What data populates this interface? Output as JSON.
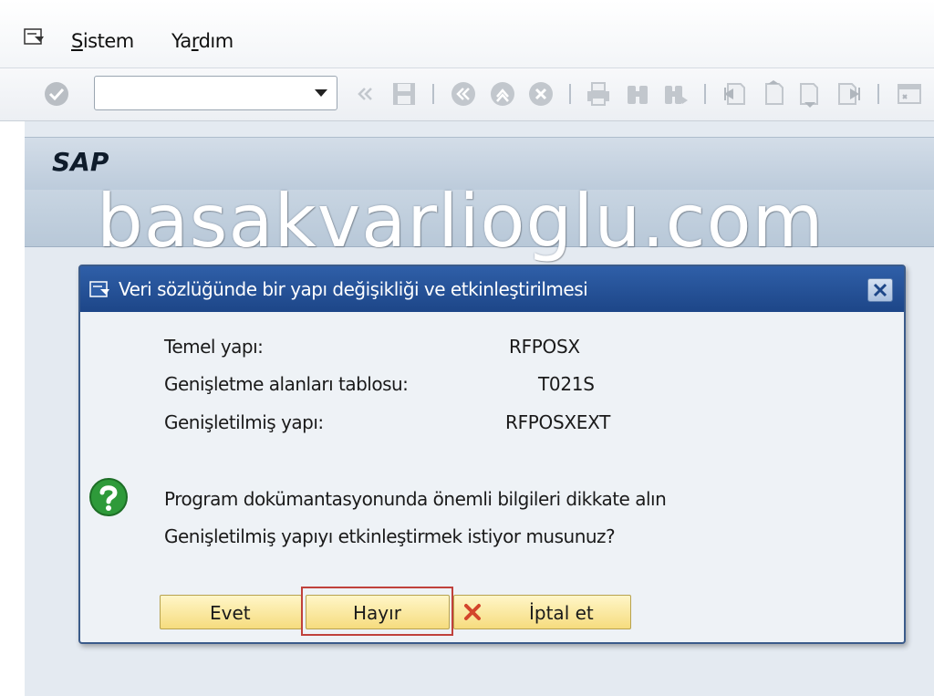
{
  "menubar": {
    "items": [
      {
        "underlined": "S",
        "rest": "istem"
      },
      {
        "pre": "Ya",
        "underlined": "r",
        "rest": "dım"
      }
    ]
  },
  "toolbar": {
    "command_field_value": "",
    "icons": [
      "enter-icon",
      "back-arrows-icon",
      "save-icon",
      "back-icon",
      "exit-icon",
      "cancel-icon",
      "print-icon",
      "find-icon",
      "find-next-icon",
      "first-page-icon",
      "previous-page-icon",
      "next-page-icon",
      "last-page-icon",
      "create-session-icon"
    ]
  },
  "header": {
    "title": "SAP"
  },
  "watermark": "basakvarlioglu.com",
  "dialog": {
    "title": "Veri sözlüğünde bir yapı değişikliği ve etkinleştirilmesi",
    "fields": [
      {
        "label": "Temel yapı:",
        "value": "RFPOSX"
      },
      {
        "label": "Genişletme alanları tablosu:",
        "value": "T021S"
      },
      {
        "label": "Genişletilmiş yapı:",
        "value": "RFPOSXEXT"
      }
    ],
    "message_icon": "question-icon",
    "messages": [
      "Program dokümantasyonunda önemli bilgileri dikkate alın",
      "Genişletilmiş yapıyı etkinleştirmek istiyor musunuz?"
    ],
    "buttons": {
      "yes": "Evet",
      "no": "Hayır",
      "cancel": "İptal et"
    }
  },
  "colors": {
    "dialog_title_bar": "#1d4688",
    "button_fill": "#f6dc7e",
    "focus_frame": "#c0413b",
    "question_icon": "#2e9a3a"
  }
}
